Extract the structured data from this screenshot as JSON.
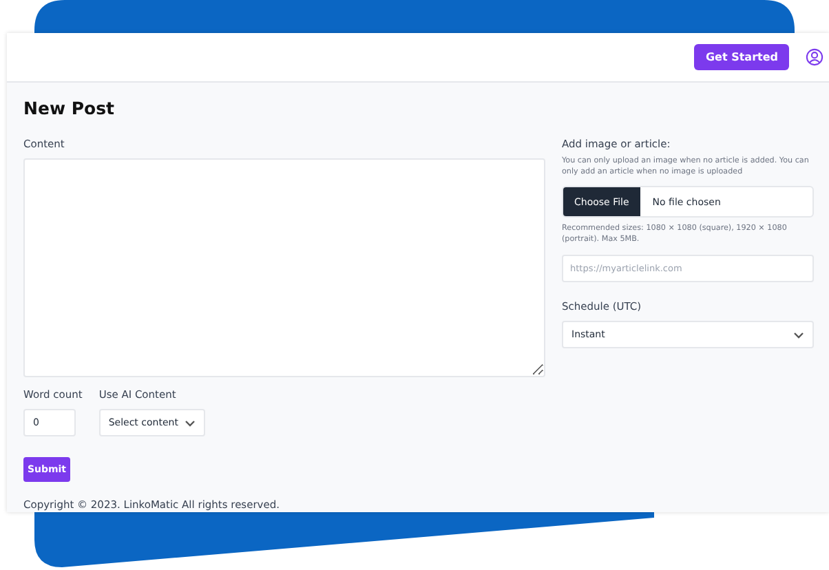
{
  "header": {
    "button": "Get Started"
  },
  "page_title": "New Post",
  "content": {
    "label": "Content"
  },
  "word_count": {
    "label": "Word count",
    "value": "0"
  },
  "ai_content": {
    "label": "Use AI Content",
    "value": "Select content"
  },
  "submit": "Submit",
  "attachment": {
    "label": "Add image or article:",
    "hint": "You can only upload an image when no article is added. You can only add an article when no image is uploaded",
    "file_button": "Choose File",
    "file_status": "No file chosen",
    "size_note": "Recommended sizes: 1080 × 1080 (square), 1920 × 1080 (portrait). Max 5MB.",
    "link_placeholder": "https://myarticlelink.com"
  },
  "schedule": {
    "label": "Schedule (UTC)",
    "value": "Instant"
  },
  "footer": "Copyright © 2023. LinkoMatic All rights reserved."
}
